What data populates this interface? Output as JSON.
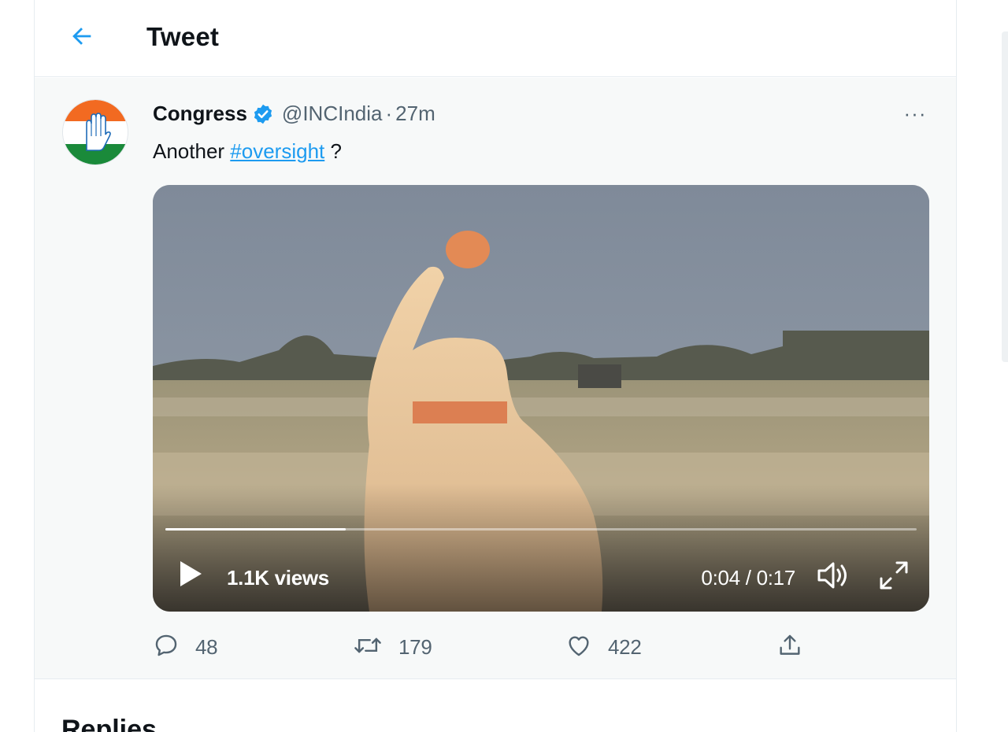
{
  "header": {
    "title": "Tweet"
  },
  "tweet": {
    "author_name": "Congress",
    "handle": "@INCIndia",
    "separator": "·",
    "time": "27m",
    "more_label": "···",
    "text_prefix": "Another ",
    "hashtag": "#oversight",
    "text_suffix": " ?"
  },
  "video": {
    "views": "1.1K views",
    "timecode": "0:04 / 0:17",
    "progress": 0.24
  },
  "actions": {
    "replies": "48",
    "retweets": "179",
    "likes": "422"
  },
  "next_section": {
    "title": "Replies"
  },
  "icons": {
    "back": "arrow-left-icon",
    "verified": "verified-badge-icon",
    "more": "more-horizontal-icon",
    "play": "play-icon",
    "volume": "volume-icon",
    "fullscreen": "fullscreen-icon",
    "reply": "reply-icon",
    "retweet": "retweet-icon",
    "like": "heart-icon",
    "share": "share-icon"
  },
  "colors": {
    "accent": "#1d9bf0",
    "secondary_text": "#536471"
  }
}
